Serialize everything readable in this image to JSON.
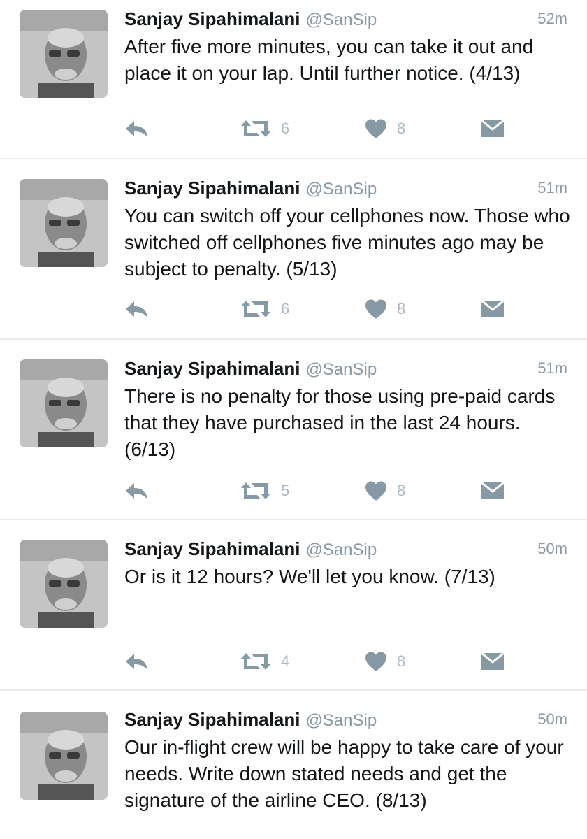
{
  "tweets": [
    {
      "name": "Sanjay Sipahimalani",
      "handle": "@SanSip",
      "time": "52m",
      "text": "After five more minutes, you can take it out and place it on your lap. Until further notice. (4/13)",
      "retweets": "6",
      "likes": "8"
    },
    {
      "name": "Sanjay Sipahimalani",
      "handle": "@SanSip",
      "time": "51m",
      "text": "You can switch off your cellphones now. Those who switched off cellphones five minutes ago may be subject to penalty. (5/13)",
      "retweets": "6",
      "likes": "8"
    },
    {
      "name": "Sanjay Sipahimalani",
      "handle": "@SanSip",
      "time": "51m",
      "text": "There is no penalty for those using pre-paid cards that they have purchased in the last 24 hours. (6/13)",
      "retweets": "5",
      "likes": "8"
    },
    {
      "name": "Sanjay Sipahimalani",
      "handle": "@SanSip",
      "time": "50m",
      "text": "Or is it 12 hours? We'll let you know. (7/13)",
      "retweets": "4",
      "likes": "8"
    },
    {
      "name": "Sanjay Sipahimalani",
      "handle": "@SanSip",
      "time": "50m",
      "text": "Our in-flight crew will be happy to take care of your needs. Write down stated needs and get the signature of the airline CEO. (8/13)",
      "retweets": "",
      "likes": ""
    }
  ],
  "icons": {
    "reply": "reply-icon",
    "retweet": "retweet-icon",
    "like": "heart-icon",
    "dm": "envelope-icon"
  },
  "colors": {
    "name": "#14171a",
    "secondary": "#8899a6",
    "icon": "#aab8c2",
    "divider": "#e6ecf0"
  }
}
